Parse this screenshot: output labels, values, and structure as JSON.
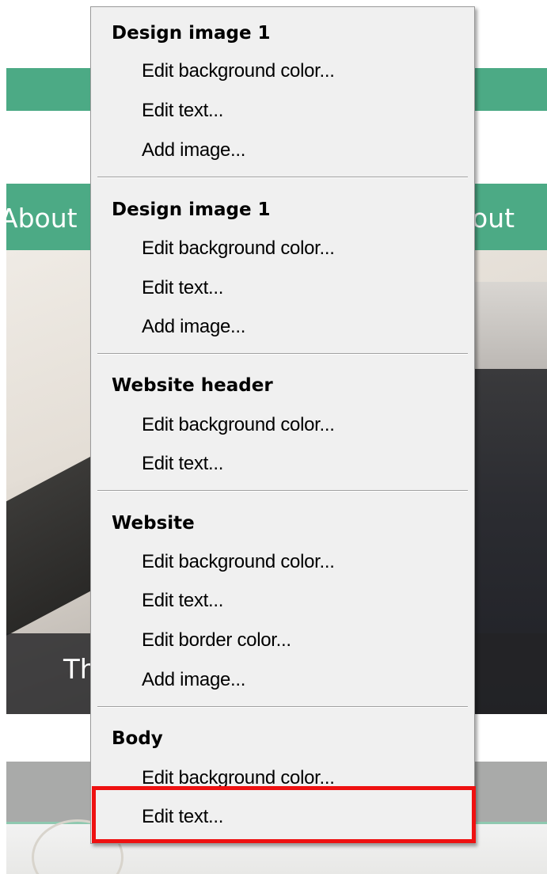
{
  "background": {
    "nav_left": "About",
    "nav_right": "out",
    "caption_fragment": "Th",
    "colors": {
      "green_band": "#4caa85",
      "gray_band": "#a9aaa9"
    }
  },
  "context_menu": {
    "sections": [
      {
        "header": "Design image 1",
        "items": [
          "Edit background color...",
          "Edit text...",
          "Add image..."
        ]
      },
      {
        "header": "Design image 1",
        "items": [
          "Edit background color...",
          "Edit text...",
          "Add image..."
        ]
      },
      {
        "header": "Website header",
        "items": [
          "Edit background color...",
          "Edit text..."
        ]
      },
      {
        "header": "Website",
        "items": [
          "Edit background color...",
          "Edit text...",
          "Edit border color...",
          "Add image..."
        ]
      },
      {
        "header": "Body",
        "items": [
          "Edit background color...",
          "Edit text..."
        ]
      }
    ],
    "highlighted_item": "Body > Edit text...",
    "highlight_color": "#ee1111"
  }
}
